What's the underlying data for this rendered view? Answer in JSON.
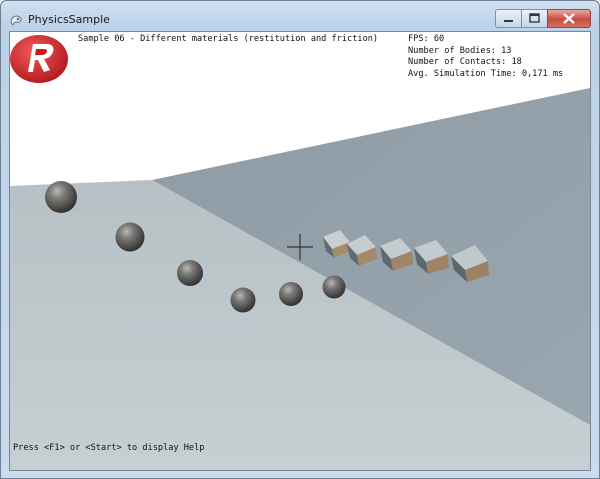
{
  "window": {
    "title": "PhysicsSample",
    "app_icon": "app-icon",
    "controls": [
      "minimize-icon",
      "maximize-icon",
      "close-icon"
    ]
  },
  "hud": {
    "sample_title": "Sample 06 - Different materials (restitution and friction)",
    "fps": "FPS: 60",
    "bodies": "Number of Bodies: 13",
    "contacts": "Number of Contacts: 18",
    "sim_time": "Avg. Simulation Time: 0,171 ms",
    "help": "Press <F1> or <Start> to display Help",
    "logo": "digitalrune-logo-icon",
    "crosshair": "crosshair-icon"
  },
  "scene": {
    "sky_color": "#ffffff",
    "ground_color": "#bfc8cb",
    "ramp_color": "#919ea8",
    "sphere_color": "#6b6a68",
    "box_color": "#9a8a74",
    "spheres": 6,
    "boxes": 5
  }
}
